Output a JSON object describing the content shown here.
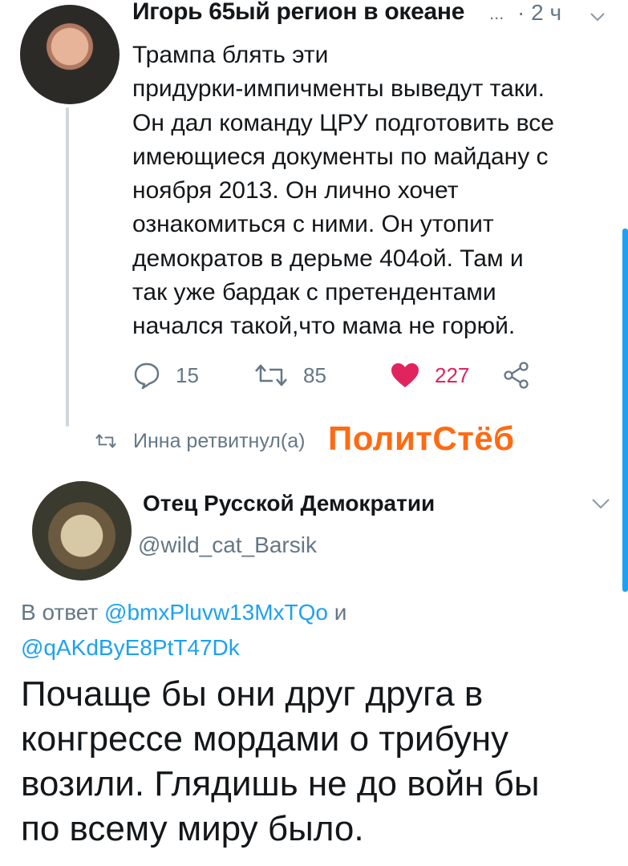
{
  "tweet1": {
    "author_name": "Игорь 65ый регион в океане",
    "name_ellipsis": "...",
    "time": "· 2 ч",
    "lines": [
      "Трампа блять эти",
      "придурки-импичменты выведут таки.",
      "Он дал команду ЦРУ подготовить все",
      "имеющиеся документы по майдану с",
      "ноября 2013. Он лично хочет",
      "ознакомиться с ними. Он утопит",
      "демократов в дерьме 404ой. Там и",
      "так уже бардак с претендентами",
      "начался такой,что мама не горюй."
    ],
    "actions": {
      "replies": "15",
      "retweets": "85",
      "likes": "227"
    },
    "icons": {
      "reply": "reply-icon",
      "retweet": "retweet-icon",
      "like": "heart-icon",
      "share": "share-icon",
      "menu": "chevron-down-icon"
    },
    "colors": {
      "like": "#e0245e",
      "muted": "#657786"
    }
  },
  "retweet_notice": {
    "text": "Инна ретвитнул(а)"
  },
  "watermark": "ПолитСтёб",
  "tweet2": {
    "author_name": "Отец Русской Демократии",
    "handle": "@wild_cat_Barsik",
    "reply_prefix": "В ответ",
    "reply_mention1": "@bmxPluvw13MxTQo",
    "reply_joiner": "и",
    "reply_mention2": "@qAKdByE8PtT47Dk",
    "lines": [
      "Почаще бы они друг друга в",
      "конгрессе мордами о трибуну",
      "возили. Глядишь не до войн бы",
      "по всему миру было."
    ],
    "colors": {
      "mention": "#1da1f2"
    }
  },
  "accent_color": "#1da1f2"
}
